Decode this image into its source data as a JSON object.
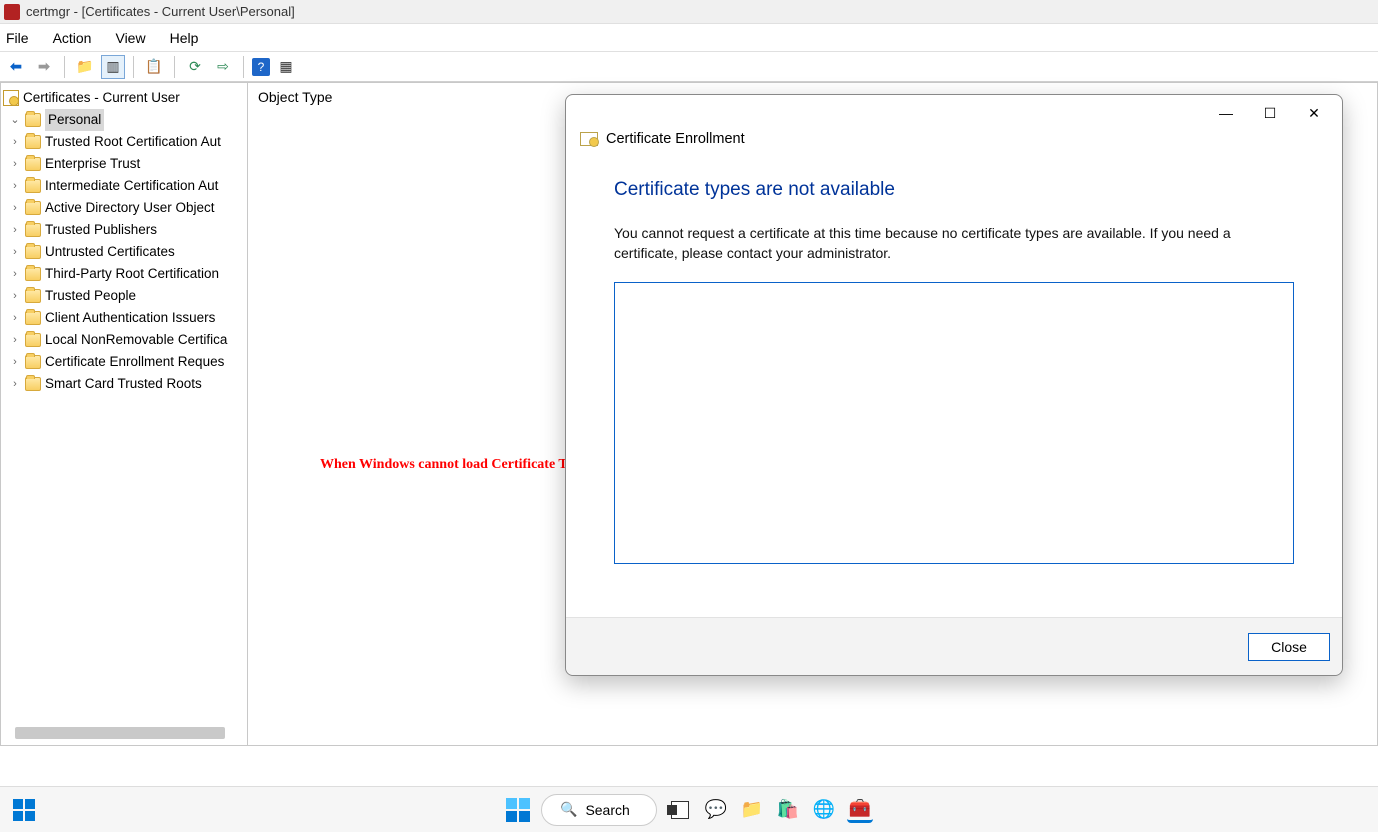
{
  "window": {
    "title": "certmgr - [Certificates - Current User\\Personal]"
  },
  "menu": {
    "file": "File",
    "action": "Action",
    "view": "View",
    "help": "Help"
  },
  "tree": {
    "root": "Certificates - Current User",
    "items": [
      "Personal",
      "Trusted Root Certification Aut",
      "Enterprise Trust",
      "Intermediate Certification Aut",
      "Active Directory User Object",
      "Trusted Publishers",
      "Untrusted Certificates",
      "Third-Party Root Certification",
      "Trusted People",
      "Client Authentication Issuers",
      "Local NonRemovable Certifica",
      "Certificate Enrollment Reques",
      "Smart Card Trusted Roots"
    ]
  },
  "content": {
    "header": "Object Type"
  },
  "annotation": "When Windows cannot load Certificate Templates from ADCS",
  "dialog": {
    "header": "Certificate Enrollment",
    "title": "Certificate types are not available",
    "text": "You cannot request a certificate at this time because no certificate types are available. If you need a certificate, please contact your administrator.",
    "close": "Close"
  },
  "taskbar": {
    "search": "Search"
  }
}
